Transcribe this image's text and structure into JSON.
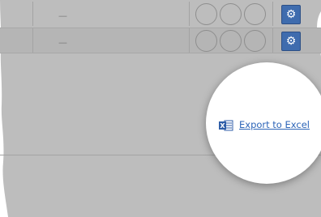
{
  "table": {
    "rows": [
      {
        "value": "—",
        "rating_slots": 3,
        "action_icon": "gear-icon"
      },
      {
        "value": "—",
        "rating_slots": 3,
        "action_icon": "gear-icon"
      }
    ]
  },
  "export": {
    "label": "Export to Excel",
    "icon": "excel-icon"
  },
  "colors": {
    "background": "#bdbdbd",
    "gear_button": "#3f6cae",
    "link": "#2d65b8",
    "excel_icon": "#2f5ea8"
  }
}
